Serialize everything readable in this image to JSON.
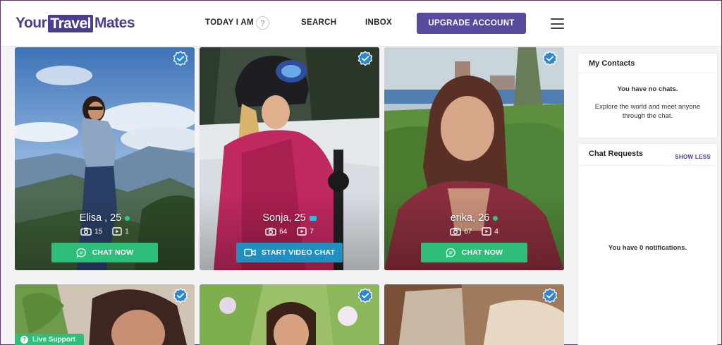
{
  "header": {
    "logo": {
      "part1": "Your",
      "part2": "Travel",
      "part3": "Mates"
    },
    "nav": {
      "today": "TODAY I AM",
      "help_icon": "?",
      "search": "SEARCH",
      "inbox": "INBOX",
      "upgrade": "UPGRADE ACCOUNT"
    }
  },
  "profiles": [
    {
      "name": "Elisa , 25",
      "photos": "15",
      "videos": "1",
      "action": "CHAT NOW",
      "status": "online"
    },
    {
      "name": "Sonja, 25",
      "photos": "64",
      "videos": "7",
      "action": "START VIDEO CHAT",
      "status": "video"
    },
    {
      "name": "erika, 26",
      "photos": "67",
      "videos": "4",
      "action": "CHAT NOW",
      "status": "online"
    }
  ],
  "live_support": {
    "label": "Live Support",
    "icon": "?"
  },
  "sidebar": {
    "contacts": {
      "title": "My Contacts",
      "empty_title": "You have no chats.",
      "empty_text_line1": "Explore the world and meet anyone",
      "empty_text_line2": "through the chat."
    },
    "requests": {
      "title": "Chat Requests",
      "toggle": "SHOW LESS",
      "empty_text": "You have 0 notifications."
    }
  },
  "colors": {
    "brand": "#4b3d8f",
    "upgrade": "#5a4a9e",
    "chat_green": "#2fbd7a",
    "video_blue": "#1f8fc0",
    "verified": "#2d86d4"
  },
  "icons": [
    "help-icon",
    "hamburger-menu-icon",
    "verified-badge-icon",
    "camera-icon",
    "video-icon",
    "chat-bubble-icon",
    "video-camera-icon"
  ]
}
